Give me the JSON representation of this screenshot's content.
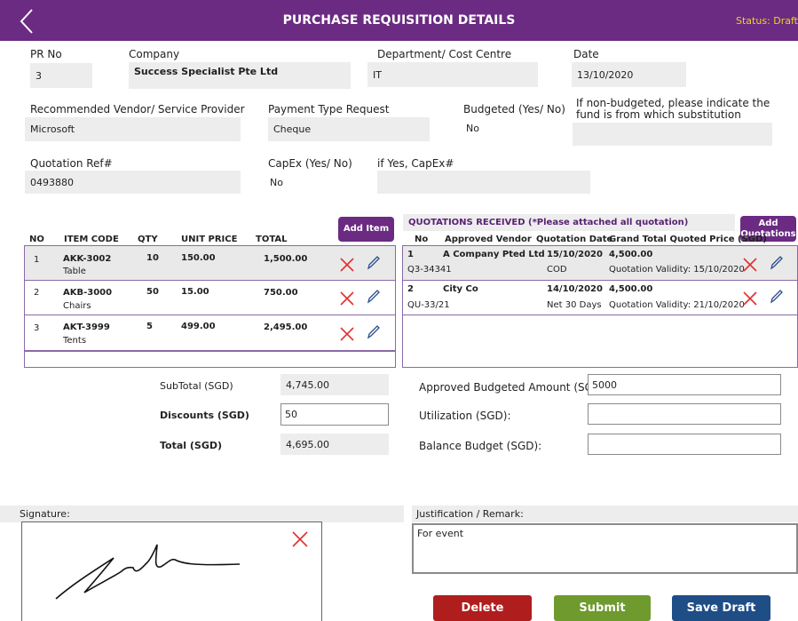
{
  "header": {
    "title": "PURCHASE REQUISITION DETAILS",
    "status": "Status:  Draft"
  },
  "form": {
    "pr_no": {
      "label": "PR No",
      "value": "3"
    },
    "company": {
      "label": "Company",
      "value": "Success Specialist Pte Ltd"
    },
    "department": {
      "label": "Department/ Cost Centre",
      "value": "IT"
    },
    "date": {
      "label": "Date",
      "value": "13/10/2020"
    },
    "vendor": {
      "label": "Recommended Vendor/ Service Provider",
      "value": "Microsoft"
    },
    "payment_type": {
      "label": "Payment Type Request",
      "value": "Cheque"
    },
    "budgeted": {
      "label": "Budgeted (Yes/ No)",
      "value": "No"
    },
    "non_budgeted": {
      "label": "If non-budgeted, please indicate the fund is from which substitution",
      "value": ""
    },
    "quotation_ref": {
      "label": "Quotation Ref#",
      "value": "0493880"
    },
    "capex": {
      "label": "CapEx (Yes/ No)",
      "value": "No"
    },
    "capex_no": {
      "label": "if Yes, CapEx#",
      "value": ""
    }
  },
  "items": {
    "add_label": "Add Item",
    "headers": [
      "NO",
      "ITEM CODE",
      "QTY",
      "UNIT PRICE",
      "TOTAL"
    ],
    "rows": [
      {
        "no": "1",
        "code": "AKK-3002",
        "desc": "Table",
        "qty": "10",
        "price": "150.00",
        "total": "1,500.00"
      },
      {
        "no": "2",
        "code": "AKB-3000",
        "desc": "Chairs",
        "qty": "50",
        "price": "15.00",
        "total": "750.00"
      },
      {
        "no": "3",
        "code": "AKT-3999",
        "desc": "Tents",
        "qty": "5",
        "price": "499.00",
        "total": "2,495.00"
      }
    ]
  },
  "quotations": {
    "title": "QUOTATIONS RECEIVED (*Please attached all quotation)",
    "add_label": "Add Quotations",
    "headers": [
      "No",
      "Approved Vendor",
      "Quotation Date",
      "Grand Total Quoted Price (SGD)"
    ],
    "rows": [
      {
        "no": "1",
        "vendor": "A Company Pted Ltd",
        "ref": "Q3-34341",
        "date": "15/10/2020",
        "terms": "COD",
        "total": "4,500.00",
        "validity": "Quotation Validity: 15/10/2020"
      },
      {
        "no": "2",
        "vendor": "City Co",
        "ref": "QU-33/21",
        "date": "14/10/2020",
        "terms": "Net 30 Days",
        "total": "4,500.00",
        "validity": "Quotation Validity: 21/10/2020"
      }
    ]
  },
  "totals": {
    "subtotal_label": "SubTotal (SGD)",
    "subtotal": "4,745.00",
    "discount_label": "Discounts (SGD)",
    "discount": "50",
    "total_label": "Total (SGD)",
    "total": "4,695.00"
  },
  "budget": {
    "approved_label": "Approved Budgeted Amount (SGD):",
    "approved": "5000",
    "utilization_label": "Utilization (SGD):",
    "utilization": "",
    "balance_label": "Balance Budget (SGD):",
    "balance": ""
  },
  "signature": {
    "label": "Signature:"
  },
  "remark": {
    "label": "Justification / Remark:",
    "value": "For event"
  },
  "actions": {
    "delete": "Delete",
    "submit": "Submit",
    "save": "Save Draft"
  },
  "colors": {
    "header": "#6b2b82",
    "status": "#f2d21b",
    "delete": "#b01d1d",
    "submit": "#6f9a2e",
    "save": "#1f4d86"
  }
}
